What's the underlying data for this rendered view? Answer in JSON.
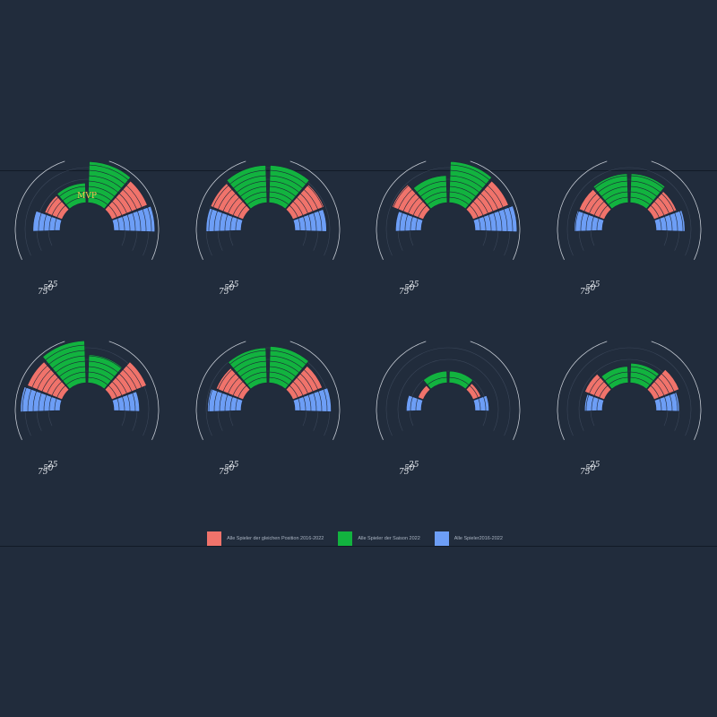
{
  "chart_data": {
    "type": "radial-bar",
    "title": "",
    "legend": {
      "placement": "bottom-center",
      "entries": [
        {
          "label": "Alle Spieler der gleichen Position 2016-2022",
          "color": "#f0736b"
        },
        {
          "label": "Alle Spieler der Saison 2022",
          "color": "#12b33f"
        },
        {
          "label": "Alle Spieler2016-2022",
          "color": "#6d9ef6"
        }
      ]
    },
    "radial_tick_labels": [
      "25",
      "50",
      "75"
    ],
    "rlim": [
      0,
      100
    ],
    "segments": [
      {
        "group": 2,
        "color": "#6d9ef6",
        "angle_deg": [
          -92,
          -70
        ]
      },
      {
        "group": 0,
        "color": "#f0736b",
        "angle_deg": [
          -68,
          -42
        ]
      },
      {
        "group": 1,
        "color": "#12b33f",
        "angle_deg": [
          -40,
          -2
        ]
      },
      {
        "group": 1,
        "color": "#12b33f",
        "angle_deg": [
          2,
          40
        ]
      },
      {
        "group": 0,
        "color": "#f0736b",
        "angle_deg": [
          42,
          68
        ]
      },
      {
        "group": 2,
        "color": "#6d9ef6",
        "angle_deg": [
          70,
          92
        ]
      }
    ],
    "players": [
      {
        "badge": "MVP",
        "values": [
          58,
          40,
          42,
          88,
          82,
          88
        ]
      },
      {
        "badge": "",
        "values": [
          75,
          75,
          80,
          80,
          72,
          68
        ]
      },
      {
        "badge": "",
        "values": [
          55,
          72,
          58,
          88,
          82,
          90
        ]
      },
      {
        "badge": "",
        "values": [
          60,
          58,
          62,
          62,
          52,
          62
        ]
      },
      {
        "badge": "",
        "values": [
          85,
          80,
          90,
          60,
          80,
          55
        ]
      },
      {
        "badge": "",
        "values": [
          72,
          62,
          75,
          78,
          68,
          78
        ]
      },
      {
        "badge": "",
        "values": [
          32,
          12,
          25,
          25,
          18,
          30
        ]
      },
      {
        "badge": "",
        "values": [
          38,
          45,
          35,
          42,
          58,
          50
        ]
      }
    ]
  }
}
